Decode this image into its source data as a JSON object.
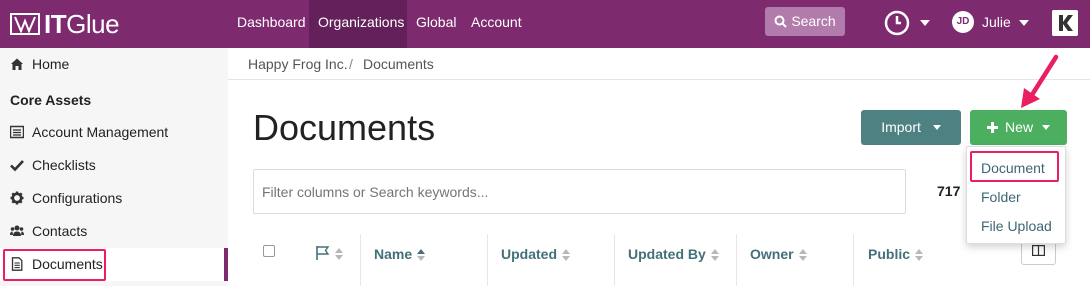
{
  "brand": {
    "name_bold": "IT",
    "name_light": "Glue"
  },
  "topnav": {
    "items": [
      {
        "label": "Dashboard",
        "active": false
      },
      {
        "label": "Organizations",
        "active": true
      },
      {
        "label": "Global",
        "active": false
      },
      {
        "label": "Account",
        "active": false
      }
    ],
    "search_label": "Search",
    "user": {
      "initials": "JD",
      "name": "Julie"
    }
  },
  "sidebar": {
    "home": "Home",
    "section_title": "Core Assets",
    "items": [
      {
        "label": "Account Management",
        "icon": "list-icon"
      },
      {
        "label": "Checklists",
        "icon": "checkmark-icon"
      },
      {
        "label": "Configurations",
        "icon": "gear-icon"
      },
      {
        "label": "Contacts",
        "icon": "users-icon"
      },
      {
        "label": "Documents",
        "icon": "document-icon",
        "active": true
      }
    ]
  },
  "breadcrumb": {
    "org": "Happy Frog Inc.",
    "separator": "/",
    "current": "Documents"
  },
  "main": {
    "title": "Documents",
    "import_label": "Import",
    "new_label": "New",
    "filter_placeholder": "Filter columns or Search keywords...",
    "record_count": "717",
    "columns": [
      "Name",
      "Updated",
      "Updated By",
      "Owner",
      "Public"
    ]
  },
  "new_menu": {
    "items": [
      "Document",
      "Folder",
      "File Upload"
    ],
    "highlighted": "Document"
  },
  "colors": {
    "topbar": "#7d2a6f",
    "import": "#4e8181",
    "new": "#4caf60",
    "annotation": "#e91e63"
  }
}
